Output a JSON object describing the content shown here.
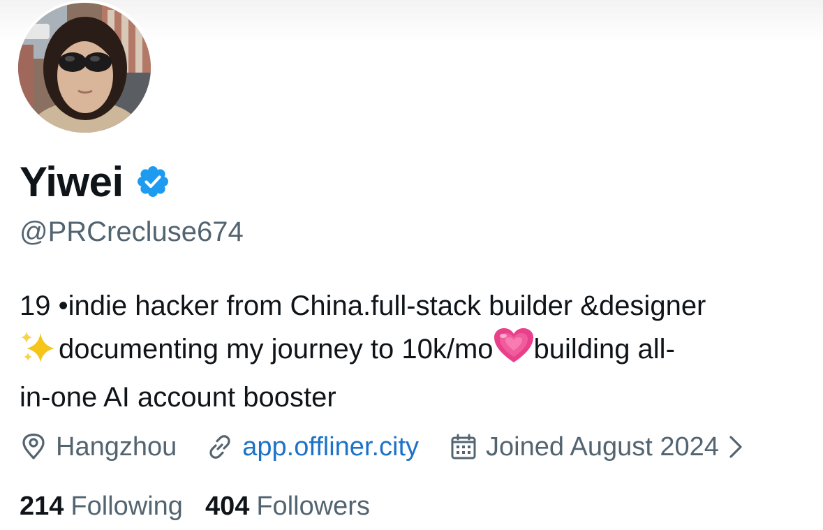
{
  "profile": {
    "display_name": "Yiwei",
    "handle": "@PRCrecluse674",
    "verified": true,
    "bio": {
      "line1": "19 •indie hacker from China.full-stack builder &designer",
      "line2_a": "documenting my journey to 10k/mo",
      "line2_b": "building all-",
      "line3": "in-one AI account booster"
    },
    "location": "Hangzhou",
    "website": "app.offliner.city",
    "joined": "Joined August 2024",
    "following_count": "214",
    "following_label": "Following",
    "followers_count": "404",
    "followers_label": "Followers"
  },
  "icons": {
    "verified": "verified-badge-icon",
    "location": "location-pin-icon",
    "link": "link-icon",
    "calendar": "calendar-icon",
    "chevron": "chevron-right-icon",
    "sparkles": "sparkles-emoji",
    "heart": "growing-heart-emoji"
  },
  "colors": {
    "verified_blue": "#1d9bf0",
    "link_blue": "#1d72c8",
    "secondary_text": "#536471",
    "primary_text": "#0f1419",
    "heart_pink": "#e8408a",
    "sparkle_gold": "#f5c518"
  }
}
